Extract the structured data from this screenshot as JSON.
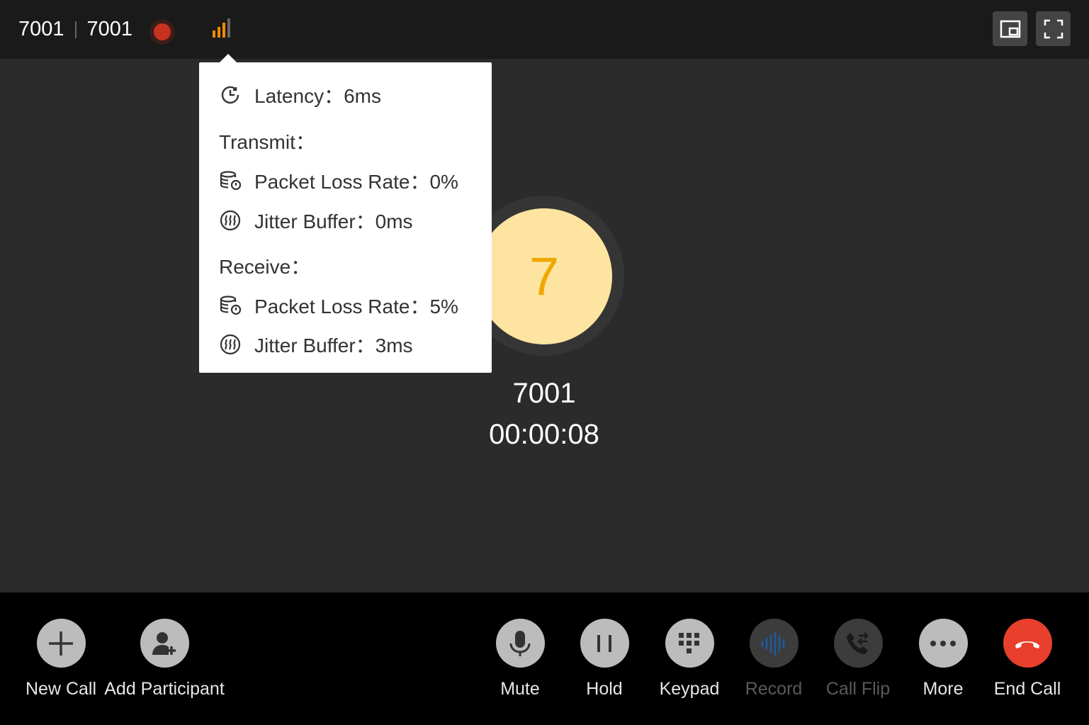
{
  "header": {
    "local_number": "7001",
    "remote_number": "7001",
    "recording_indicator": "record-dot-icon",
    "signal_icon": "signal-strength-icon",
    "pip_icon": "picture-in-picture-icon",
    "fullscreen_icon": "fullscreen-icon",
    "recording_color": "#c7321f",
    "signal_color": "#f08a00"
  },
  "call": {
    "avatar_initial": "7",
    "caller_name": "7001",
    "duration": "00:00:08",
    "avatar_color": "#fde4a0",
    "avatar_text_color": "#f0a800"
  },
  "stats_popover": {
    "latency": "Latency：6ms",
    "transmit_heading": "Transmit：",
    "transmit_packet_loss": "Packet Loss Rate：0%",
    "transmit_jitter": "Jitter Buffer：0ms",
    "receive_heading": "Receive：",
    "receive_packet_loss": "Packet Loss Rate：5%",
    "receive_jitter": "Jitter Buffer：3ms"
  },
  "toolbar": {
    "new_call": "New Call",
    "add_participant": "Add Participant",
    "mute": "Mute",
    "hold": "Hold",
    "keypad": "Keypad",
    "record": "Record",
    "call_flip": "Call Flip",
    "more": "More",
    "end_call": "End Call",
    "end_call_color": "#e8402c"
  }
}
